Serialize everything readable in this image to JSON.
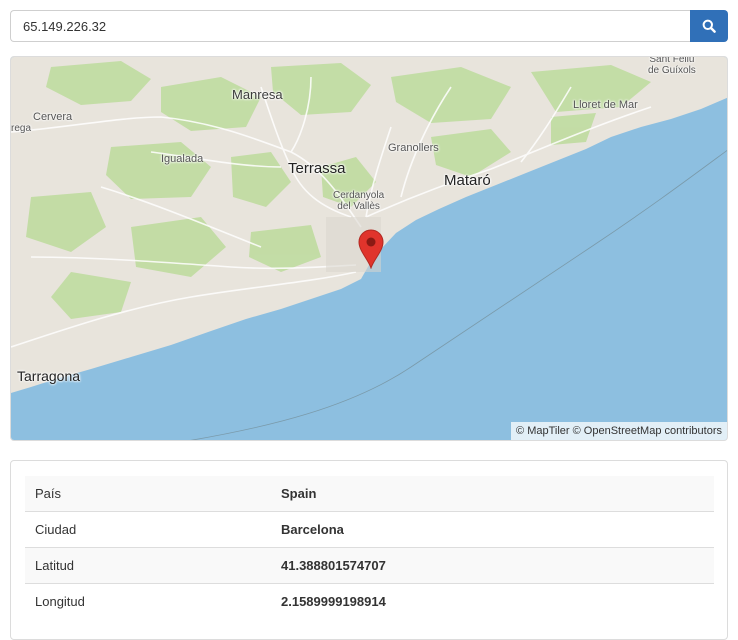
{
  "search": {
    "value": "65.149.226.32"
  },
  "colors": {
    "accent": "#3070b8",
    "sea": "#8dbfe0",
    "land": "#e8e4dc",
    "forest": "#bfdca0",
    "marker": "#e0342c"
  },
  "icons": {
    "search_button": "search-icon",
    "marker": "map-pin-icon"
  },
  "map": {
    "labels": {
      "manresa": "Manresa",
      "cervera": "Cervera",
      "rega": "rega",
      "igualada": "Igualada",
      "terrassa": "Terrassa",
      "granollers": "Granollers",
      "mataro": "Mataró",
      "cerdanyola": "Cerdanyola",
      "del_valles": "del Vallès",
      "lloret": "Lloret de Mar",
      "sant_feliu": "Sant Feliu",
      "de_guixols": "de Guíxols",
      "tarragona": "Tarragona"
    },
    "attribution": "© MapTiler © OpenStreetMap contributors"
  },
  "details": {
    "rows": [
      {
        "label": "País",
        "value": "Spain"
      },
      {
        "label": "Ciudad",
        "value": "Barcelona"
      },
      {
        "label": "Latitud",
        "value": "41.388801574707"
      },
      {
        "label": "Longitud",
        "value": "2.1589999198914"
      }
    ]
  }
}
